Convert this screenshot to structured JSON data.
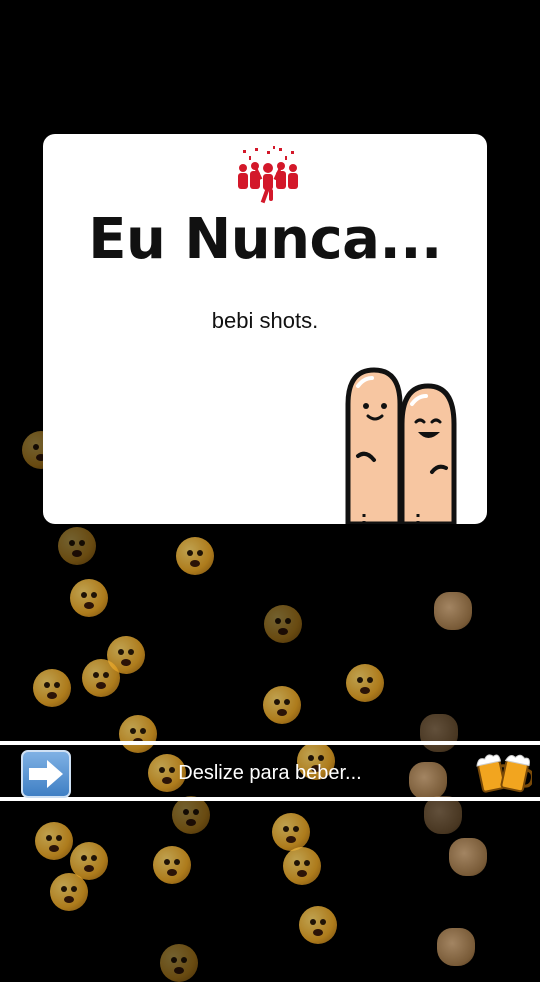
{
  "card": {
    "title": "Eu Nunca...",
    "prompt": "bebi shots.",
    "party_icon": "party-crowd-icon",
    "illustration": "two-fingers-friends-icon"
  },
  "slider": {
    "label": "Deslize para beber...",
    "handle_icon": "arrow-right-icon",
    "target_icon": "beer-mugs-icon"
  },
  "colors": {
    "background": "#000000",
    "card": "#ffffff",
    "accent_red": "#d3182a",
    "finger_skin": "#f7c6a1"
  }
}
